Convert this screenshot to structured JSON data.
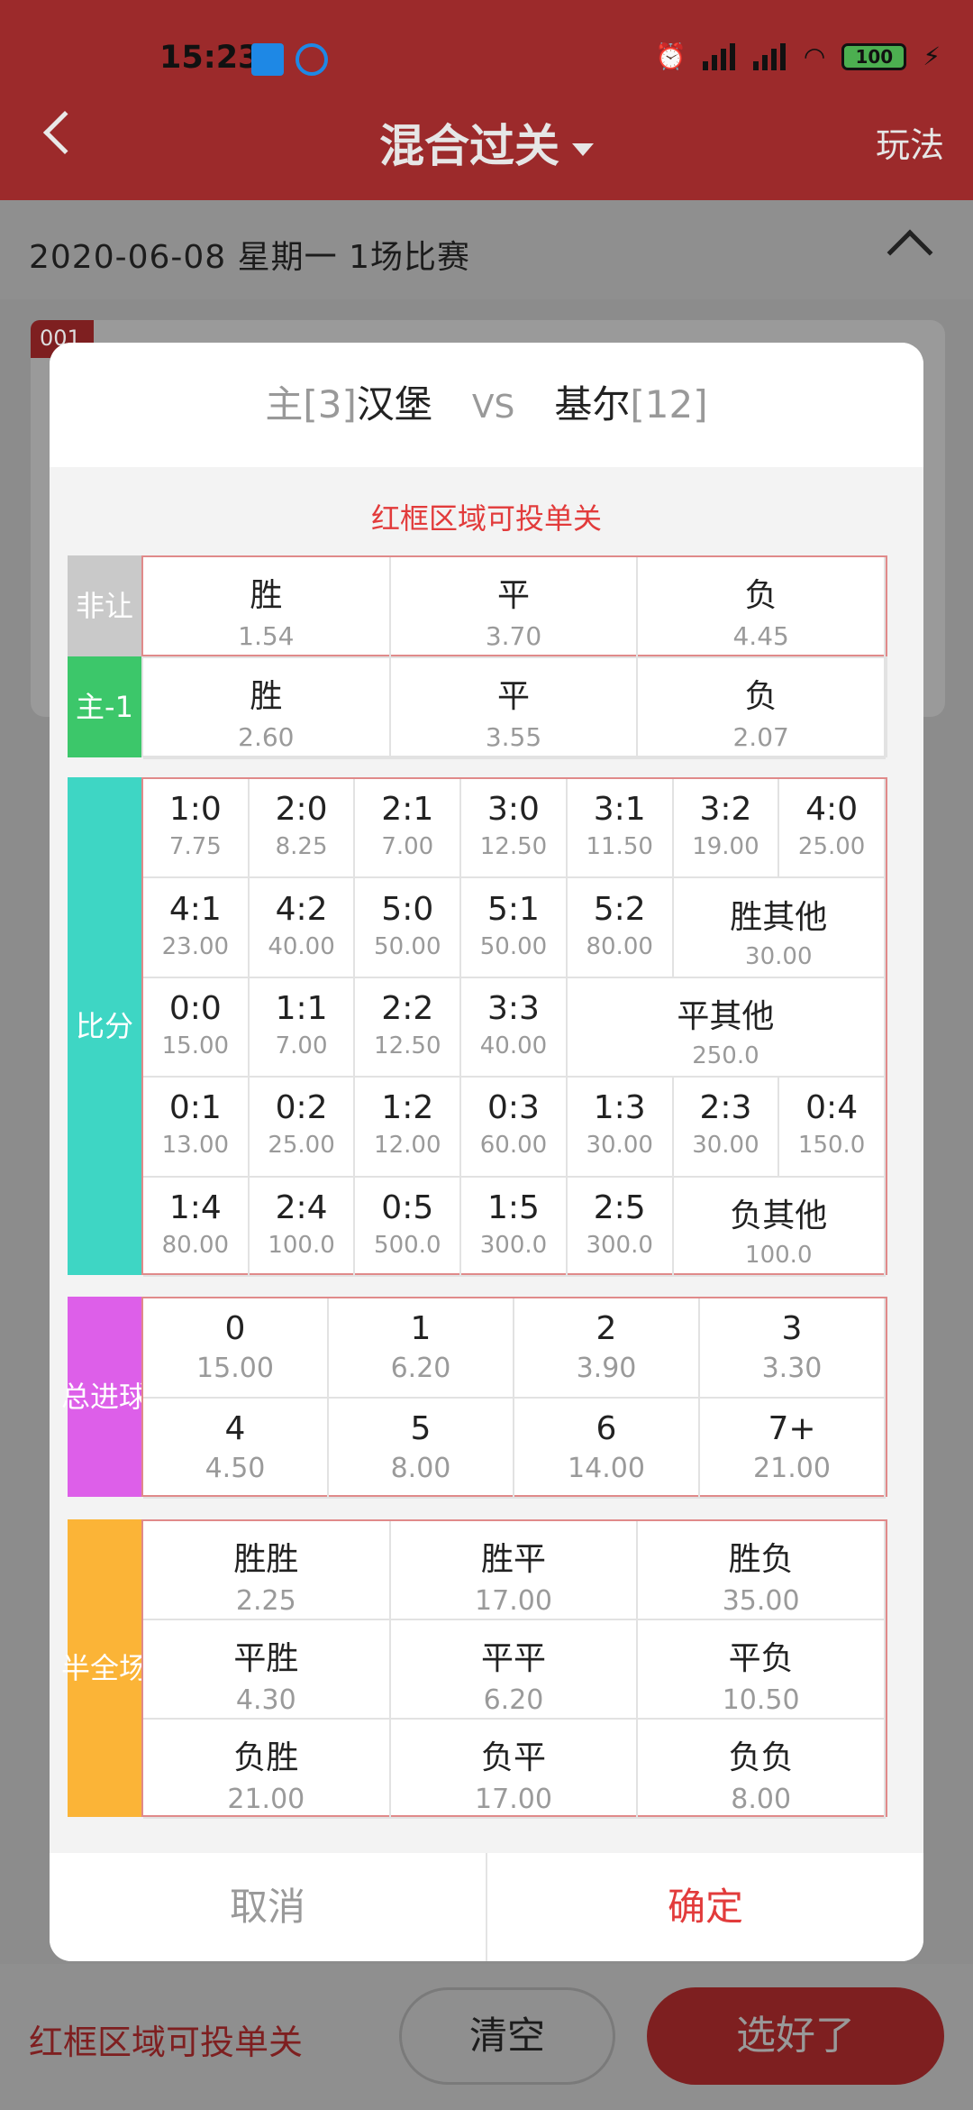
{
  "status_bar": {
    "time": "15:23",
    "battery": "100"
  },
  "header": {
    "title": "混合过关",
    "play_label": "玩法"
  },
  "date_bar": {
    "text": "2020-06-08   星期一   1场比赛"
  },
  "bg_card_tag": "001",
  "dialog": {
    "home_prefix": "主[3]",
    "home_team": "汉堡",
    "vs": "VS",
    "away_team": "基尔",
    "away_rank": "[12]",
    "red_hint": "红框区域可投单关",
    "sections": {
      "non_handicap": {
        "label": "非让",
        "color": "#c9c9c9",
        "cells": [
          {
            "n": "胜",
            "o": "1.54"
          },
          {
            "n": "平",
            "o": "3.70"
          },
          {
            "n": "负",
            "o": "4.45"
          }
        ]
      },
      "handicap": {
        "label": "主-1",
        "color": "#3cc76a",
        "cells": [
          {
            "n": "胜",
            "o": "2.60"
          },
          {
            "n": "平",
            "o": "3.55"
          },
          {
            "n": "负",
            "o": "2.07"
          }
        ]
      },
      "score": {
        "label": "比分",
        "color": "#3ed6c4",
        "cells": [
          {
            "n": "1:0",
            "o": "7.75"
          },
          {
            "n": "2:0",
            "o": "8.25"
          },
          {
            "n": "2:1",
            "o": "7.00"
          },
          {
            "n": "3:0",
            "o": "12.50"
          },
          {
            "n": "3:1",
            "o": "11.50"
          },
          {
            "n": "3:2",
            "o": "19.00"
          },
          {
            "n": "4:0",
            "o": "25.00"
          },
          {
            "n": "4:1",
            "o": "23.00"
          },
          {
            "n": "4:2",
            "o": "40.00"
          },
          {
            "n": "5:0",
            "o": "50.00"
          },
          {
            "n": "5:1",
            "o": "50.00"
          },
          {
            "n": "5:2",
            "o": "80.00"
          },
          {
            "n": "胜其他",
            "o": "30.00"
          },
          {
            "n": "0:0",
            "o": "15.00"
          },
          {
            "n": "1:1",
            "o": "7.00"
          },
          {
            "n": "2:2",
            "o": "12.50"
          },
          {
            "n": "3:3",
            "o": "40.00"
          },
          {
            "n": "平其他",
            "o": "250.0"
          },
          {
            "n": "0:1",
            "o": "13.00"
          },
          {
            "n": "0:2",
            "o": "25.00"
          },
          {
            "n": "1:2",
            "o": "12.00"
          },
          {
            "n": "0:3",
            "o": "60.00"
          },
          {
            "n": "1:3",
            "o": "30.00"
          },
          {
            "n": "2:3",
            "o": "30.00"
          },
          {
            "n": "0:4",
            "o": "150.0"
          },
          {
            "n": "1:4",
            "o": "80.00"
          },
          {
            "n": "2:4",
            "o": "100.0"
          },
          {
            "n": "0:5",
            "o": "500.0"
          },
          {
            "n": "1:5",
            "o": "300.0"
          },
          {
            "n": "2:5",
            "o": "300.0"
          },
          {
            "n": "负其他",
            "o": "100.0"
          }
        ]
      },
      "total_goals": {
        "label": "总进球",
        "color": "#dd5fe9",
        "cells": [
          {
            "n": "0",
            "o": "15.00"
          },
          {
            "n": "1",
            "o": "6.20"
          },
          {
            "n": "2",
            "o": "3.90"
          },
          {
            "n": "3",
            "o": "3.30"
          },
          {
            "n": "4",
            "o": "4.50"
          },
          {
            "n": "5",
            "o": "8.00"
          },
          {
            "n": "6",
            "o": "14.00"
          },
          {
            "n": "7+",
            "o": "21.00"
          }
        ]
      },
      "half_full": {
        "label": "半全场",
        "color": "#fbb437",
        "cells": [
          {
            "n": "胜胜",
            "o": "2.25"
          },
          {
            "n": "胜平",
            "o": "17.00"
          },
          {
            "n": "胜负",
            "o": "35.00"
          },
          {
            "n": "平胜",
            "o": "4.30"
          },
          {
            "n": "平平",
            "o": "6.20"
          },
          {
            "n": "平负",
            "o": "10.50"
          },
          {
            "n": "负胜",
            "o": "21.00"
          },
          {
            "n": "负平",
            "o": "17.00"
          },
          {
            "n": "负负",
            "o": "8.00"
          }
        ]
      }
    },
    "cancel_label": "取消",
    "confirm_label": "确定"
  },
  "bottom_bar": {
    "hint": "红框区域可投单关",
    "clear_label": "清空",
    "done_label": "选好了"
  }
}
